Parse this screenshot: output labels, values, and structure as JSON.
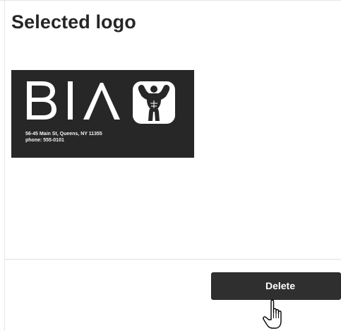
{
  "section": {
    "title": "Selected logo"
  },
  "logo": {
    "wordmark": "BIA",
    "address_line1": "56-45 Main St, Queens, NY 11355",
    "address_line2": "phone: 555-0101",
    "background_color": "#272727",
    "foreground_color": "#ffffff",
    "emblem": "bodybuilder-icon"
  },
  "actions": {
    "delete_label": "Delete"
  },
  "cursor": {
    "type": "hand-pointer-icon"
  }
}
